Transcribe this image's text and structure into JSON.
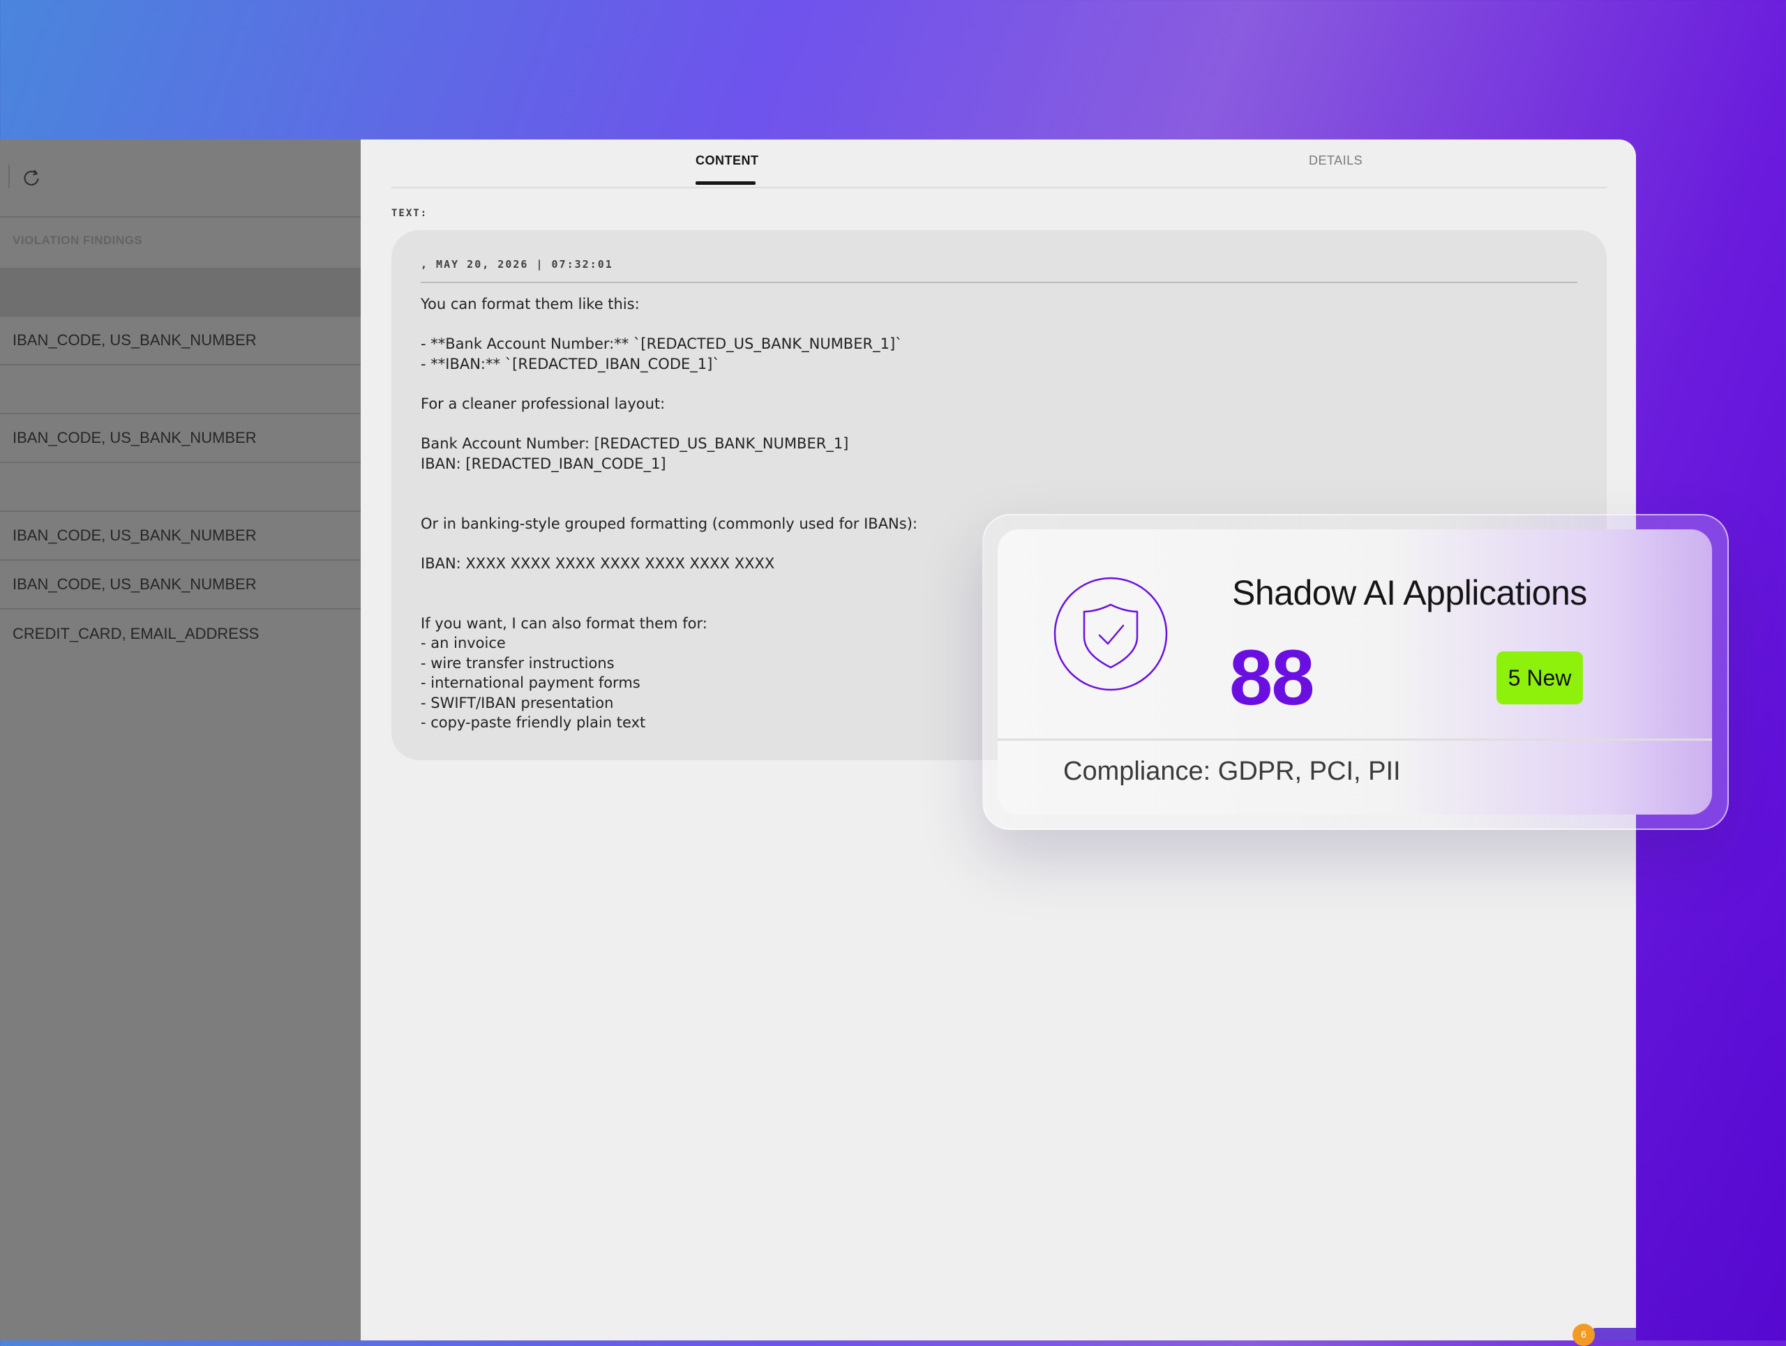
{
  "left_panel": {
    "section_label": "VIOLATION FINDINGS",
    "rows": [
      "",
      "IBAN_CODE, US_BANK_NUMBER",
      "",
      "IBAN_CODE, US_BANK_NUMBER",
      "",
      "IBAN_CODE, US_BANK_NUMBER",
      "IBAN_CODE, US_BANK_NUMBER",
      "CREDIT_CARD, EMAIL_ADDRESS"
    ]
  },
  "tabs": {
    "content": "CONTENT",
    "details": "DETAILS"
  },
  "text_label": "TEXT:",
  "message": {
    "meta": ", MAY 20, 2026 | 07:32:01",
    "body": "You can format them like this:\n\n- **Bank Account Number:** `[REDACTED_US_BANK_NUMBER_1]`\n- **IBAN:** `[REDACTED_IBAN_CODE_1]`\n\nFor a cleaner professional layout:\n\nBank Account Number: [REDACTED_US_BANK_NUMBER_1]\nIBAN: [REDACTED_IBAN_CODE_1]\n\n\nOr in banking-style grouped formatting (commonly used for IBANs):\n\nIBAN: XXXX XXXX XXXX XXXX XXXX XXXX XXXX\n\n\nIf you want, I can also format them for:\n- an invoice\n- wire transfer instructions\n- international payment forms\n- SWIFT/IBAN presentation\n- copy-paste friendly plain text"
  },
  "overlay": {
    "title": "Shadow AI Applications",
    "count": "88",
    "badge": "5 New",
    "compliance": "Compliance: GDPR, PCI, PII"
  },
  "chat_widget": {
    "badge_count": "6"
  },
  "colors": {
    "accent_purple": "#6a0fe0",
    "badge_green": "#8ef10c"
  },
  "icons": [
    "refresh-icon",
    "shield-check-icon"
  ]
}
